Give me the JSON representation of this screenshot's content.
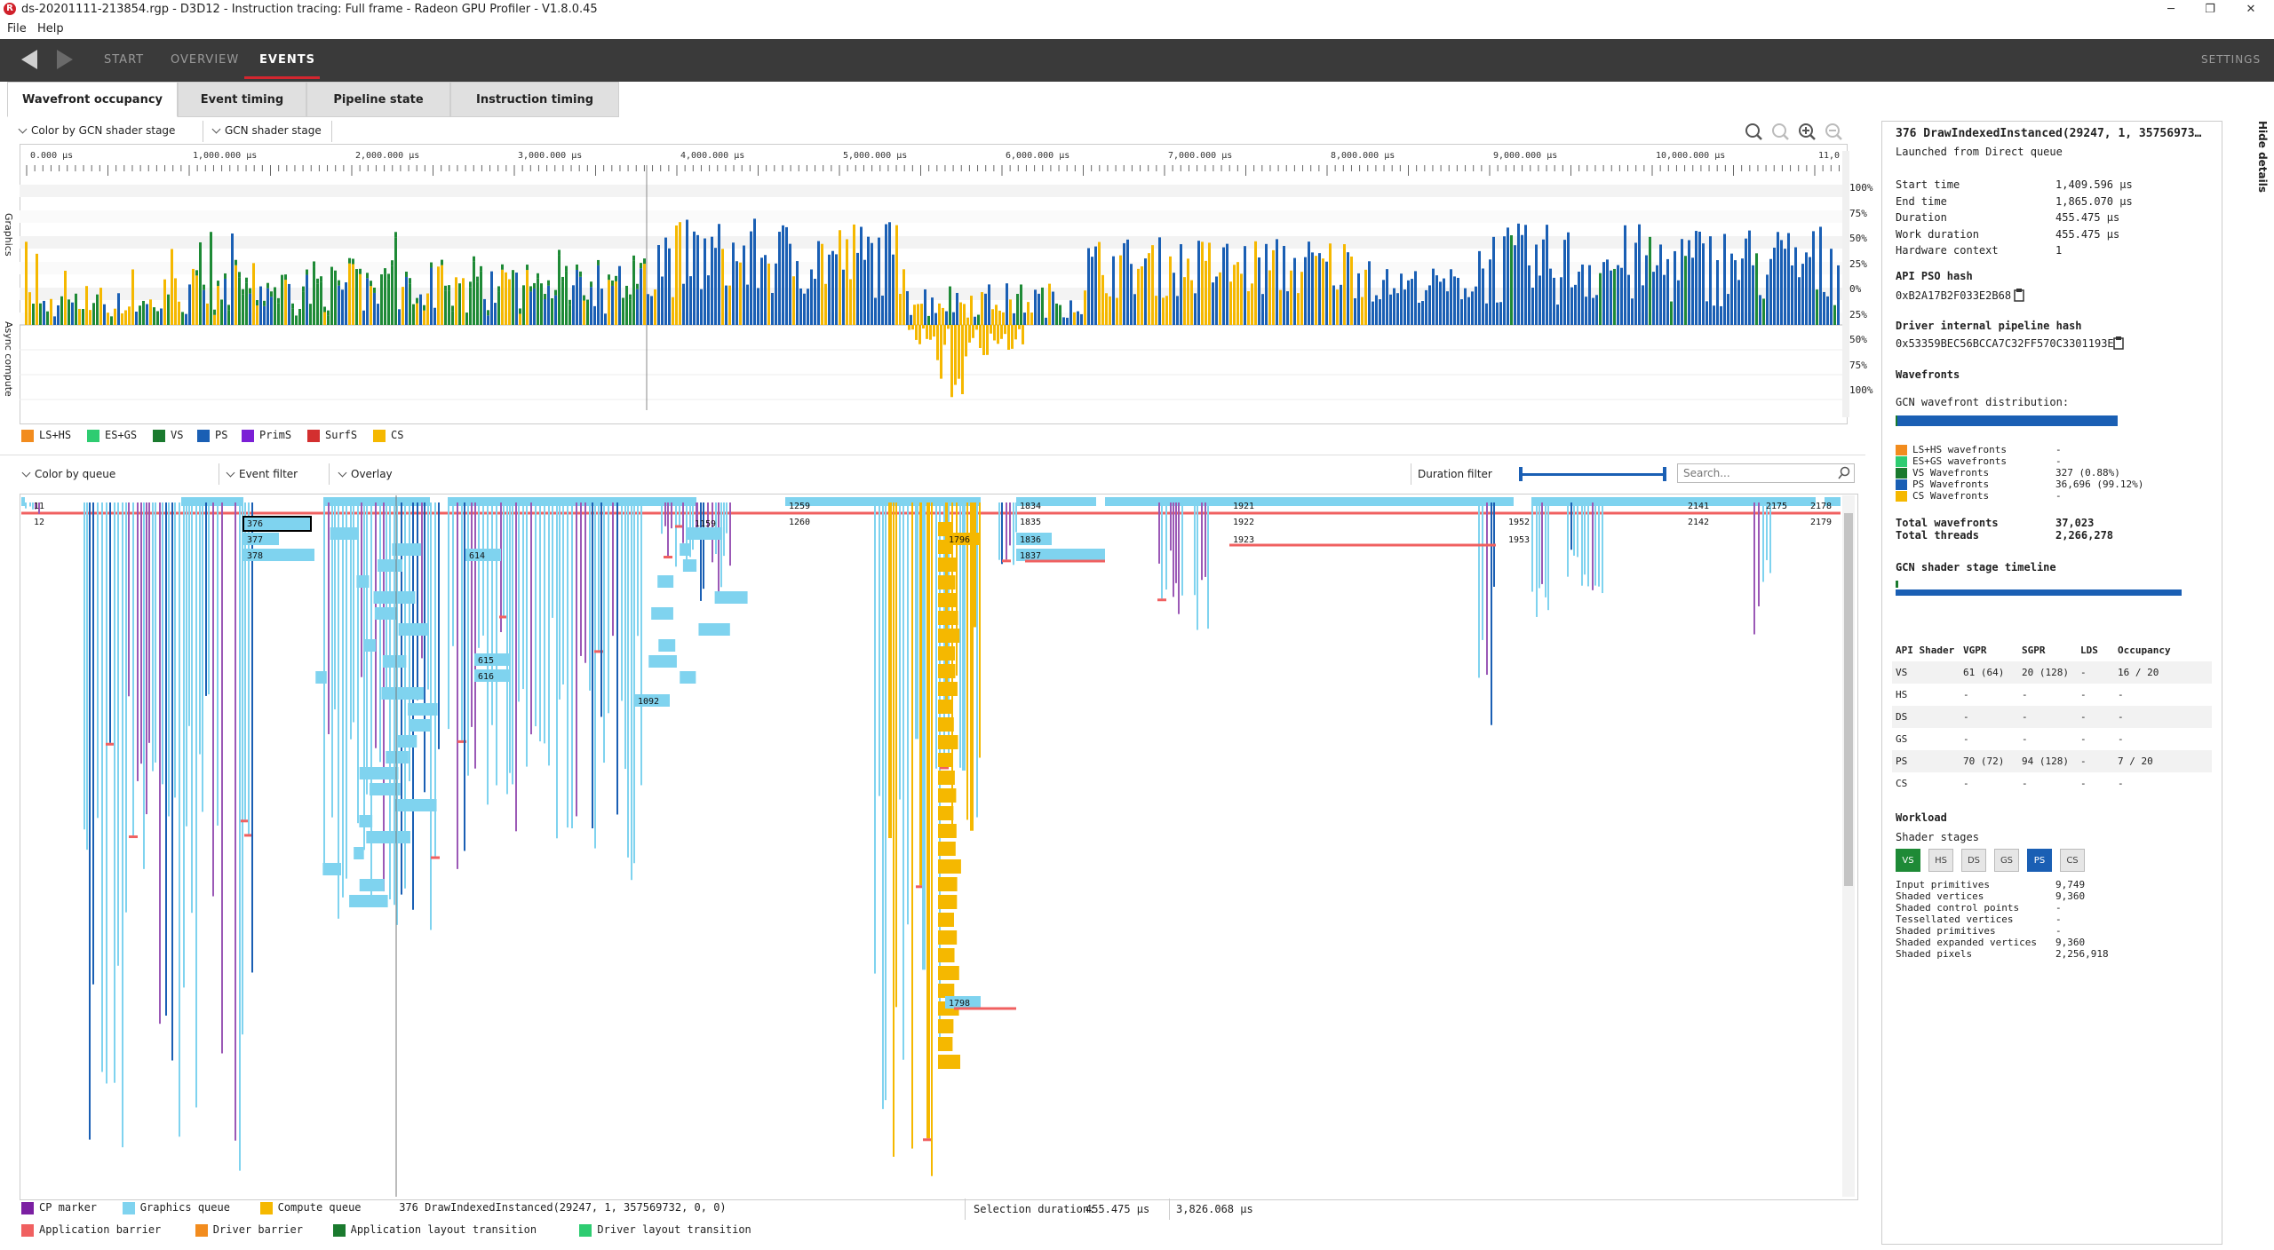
{
  "window": {
    "title": "ds-20201111-213854.rgp - D3D12 - Instruction tracing: Full frame - Radeon GPU Profiler - V1.8.0.45",
    "controls": [
      "─",
      "❐",
      "✕"
    ]
  },
  "menu": [
    "File",
    "Help"
  ],
  "nav": {
    "tabs": [
      "START",
      "OVERVIEW",
      "EVENTS"
    ],
    "active_tab": "EVENTS",
    "settings_label": "SETTINGS"
  },
  "subtabs": [
    "Wavefront occupancy",
    "Event timing",
    "Pipeline state",
    "Instruction timing"
  ],
  "occupancy": {
    "color_by": "Color by GCN shader stage",
    "stage_select": "GCN shader stage",
    "side_labels": [
      "Graphics",
      "Async compute"
    ],
    "time_ticks": [
      "0.000 µs",
      "1,000.000 µs",
      "2,000.000 µs",
      "3,000.000 µs",
      "4,000.000 µs",
      "5,000.000 µs",
      "6,000.000 µs",
      "7,000.000 µs",
      "8,000.000 µs",
      "9,000.000 µs",
      "10,000.000 µs",
      "11,0"
    ],
    "pct_ticks": [
      "100%",
      "75%",
      "50%",
      "25%",
      "0%",
      "25%",
      "50%",
      "75%",
      "100%"
    ],
    "legend": [
      {
        "label": "LS+HS",
        "color": "#f28c1e"
      },
      {
        "label": "ES+GS",
        "color": "#2ecc71"
      },
      {
        "label": "VS",
        "color": "#1a7a2e"
      },
      {
        "label": "PS",
        "color": "#1a5fb4"
      },
      {
        "label": "PrimS",
        "color": "#7b1fd6"
      },
      {
        "label": "SurfS",
        "color": "#d32f2f"
      },
      {
        "label": "CS",
        "color": "#f5b800"
      }
    ],
    "colors": {
      "ps": "#1a5fb4",
      "vs": "#1e8a36",
      "cs": "#f5b800"
    }
  },
  "event_timing": {
    "color_by": "Color by queue",
    "event_filter": "Event filter",
    "overlay": "Overlay",
    "duration_filter": "Duration filter",
    "search_placeholder": "Search...",
    "event_labels": [
      "11",
      "12",
      "376",
      "377",
      "378",
      "614",
      "615",
      "616",
      "1092",
      "1159",
      "1259",
      "1260",
      "1796",
      "1798",
      "1834",
      "1835",
      "1836",
      "1837",
      "1921",
      "1922",
      "1923",
      "1952",
      "1953",
      "2141",
      "2142",
      "2175",
      "2178",
      "2179"
    ]
  },
  "bottom_legend": {
    "row1": [
      {
        "label": "CP marker",
        "color": "#7b1fa2"
      },
      {
        "label": "Graphics queue",
        "color": "#7fd3ef"
      },
      {
        "label": "Compute queue",
        "color": "#f5b800"
      }
    ],
    "row2": [
      {
        "label": "Application barrier",
        "color": "#f06060"
      },
      {
        "label": "Driver barrier",
        "color": "#f28c1e"
      },
      {
        "label": "Application layout transition",
        "color": "#1a7a2e"
      },
      {
        "label": "Driver layout transition",
        "color": "#2ecc71"
      }
    ],
    "selected_event": "376 DrawIndexedInstanced(29247, 1, 357569732, 0, 0)",
    "selection_duration_label": "Selection duration:",
    "selection_duration": "455.475 µs",
    "total_duration": "3,826.068 µs"
  },
  "details": {
    "title": "376 DrawIndexedInstanced(29247, 1, 35756973…",
    "launched_from": "Launched from Direct queue",
    "hide_label": "Hide details",
    "timing": [
      {
        "k": "Start time",
        "v": "1,409.596 µs"
      },
      {
        "k": "End time",
        "v": "1,865.070 µs"
      },
      {
        "k": "Duration",
        "v": "455.475 µs"
      },
      {
        "k": "Work duration",
        "v": "455.475 µs"
      },
      {
        "k": "Hardware context",
        "v": "1"
      }
    ],
    "api_pso_hash_label": "API PSO hash",
    "api_pso_hash": "0xB2A17B2F033E2B68",
    "driver_hash_label": "Driver internal pipeline hash",
    "driver_hash": "0x53359BEC56BCCA7C32FF570C3301193E",
    "wavefronts_label": "Wavefronts",
    "distribution_label": "GCN wavefront distribution:",
    "wave_rows": [
      {
        "label": "LS+HS wavefronts",
        "v": "-",
        "color": "#f28c1e"
      },
      {
        "label": "ES+GS wavefronts",
        "v": "-",
        "color": "#2ecc71"
      },
      {
        "label": "VS Wavefronts",
        "v": "327 (0.88%)",
        "color": "#1a7a2e"
      },
      {
        "label": "PS Wavefronts",
        "v": "36,696 (99.12%)",
        "color": "#1a5fb4"
      },
      {
        "label": "CS Wavefronts",
        "v": "-",
        "color": "#f5b800"
      }
    ],
    "total_wavefronts_label": "Total wavefronts",
    "total_wavefronts": "37,023",
    "total_threads_label": "Total threads",
    "total_threads": "2,266,278",
    "timeline_label": "GCN shader stage timeline",
    "shader_table": {
      "headers": [
        "API Shader",
        "VGPR",
        "SGPR",
        "LDS",
        "Occupancy"
      ],
      "rows": [
        [
          "VS",
          "61 (64)",
          "20 (128)",
          "-",
          "16 / 20"
        ],
        [
          "HS",
          "-",
          "-",
          "-",
          "-"
        ],
        [
          "DS",
          "-",
          "-",
          "-",
          "-"
        ],
        [
          "GS",
          "-",
          "-",
          "-",
          "-"
        ],
        [
          "PS",
          "70 (72)",
          "94 (128)",
          "-",
          "7 / 20"
        ],
        [
          "CS",
          "-",
          "-",
          "-",
          "-"
        ]
      ]
    },
    "workload_label": "Workload",
    "shader_stages_label": "Shader stages",
    "stages": [
      "VS",
      "HS",
      "DS",
      "GS",
      "PS",
      "CS"
    ],
    "workload": [
      {
        "k": "Input primitives",
        "v": "9,749"
      },
      {
        "k": "Shaded vertices",
        "v": "9,360"
      },
      {
        "k": "Shaded control points",
        "v": "-"
      },
      {
        "k": "Tessellated vertices",
        "v": "-"
      },
      {
        "k": "Shaded primitives",
        "v": "-"
      },
      {
        "k": "Shaded expanded vertices",
        "v": "9,360"
      },
      {
        "k": "Shaded pixels",
        "v": "2,256,918"
      }
    ]
  }
}
